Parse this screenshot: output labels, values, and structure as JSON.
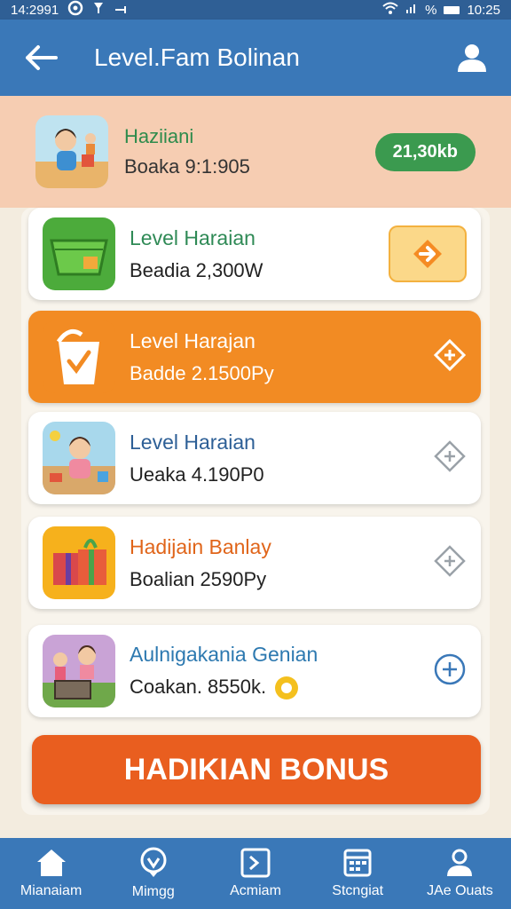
{
  "status_bar": {
    "time_left": "14:2991",
    "time_right": "10:25",
    "signal_text": "%"
  },
  "header": {
    "title": "Level.Fam Bolinan"
  },
  "summary": {
    "name": "Haziiani",
    "subtitle": "Boaka 9:1:905",
    "badge": "21,30kb"
  },
  "items": [
    {
      "title": "Level Haraian",
      "subtitle": "Beadia 2,300W"
    },
    {
      "title": "Level Harajan",
      "subtitle": "Badde 2.1500Py"
    },
    {
      "title": "Level Haraian",
      "subtitle": "Ueaka 4.190P0"
    },
    {
      "title": "Hadijain Banlay",
      "subtitle": "Boalian 2590Py"
    },
    {
      "title": "Aulnigakania Genian",
      "subtitle": "Coakan. 8550k."
    }
  ],
  "bonus_button": "HADIKIAN BONUS",
  "nav": [
    {
      "label": "Mianaiam",
      "icon": "home-icon"
    },
    {
      "label": "Mimgg",
      "icon": "location-pin-icon"
    },
    {
      "label": "Acmiam",
      "icon": "terminal-icon"
    },
    {
      "label": "Stcngiat",
      "icon": "calendar-icon"
    },
    {
      "label": "JAe Ouats",
      "icon": "user-icon"
    }
  ],
  "colors": {
    "header": "#3a78b8",
    "summary_bg": "#f6cdb2",
    "badge": "#3b9a4f",
    "highlight_card": "#f28b23",
    "bonus": "#e95e1f"
  }
}
